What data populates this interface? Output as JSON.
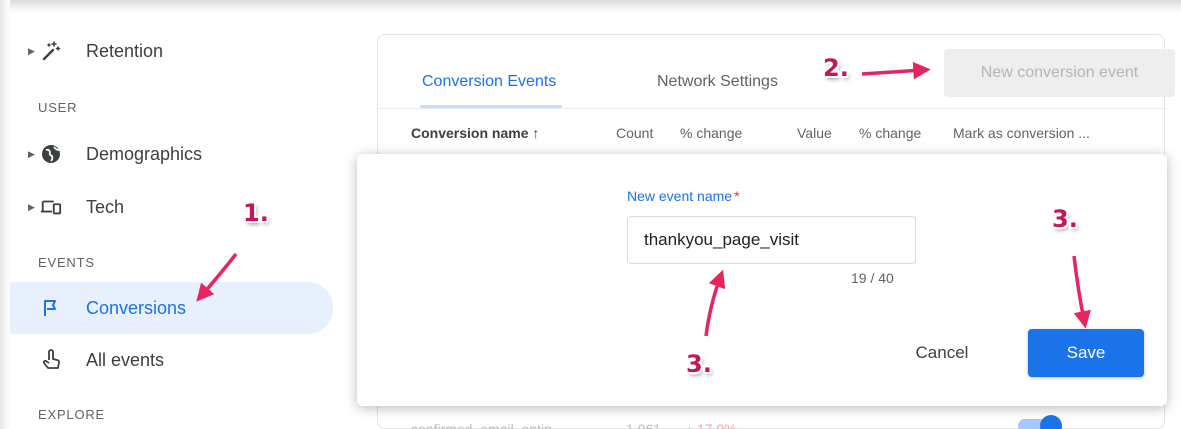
{
  "sidebar": {
    "items": [
      {
        "label": "Retention",
        "icon": "magic-wand-icon"
      },
      {
        "label": "Demographics",
        "icon": "globe-icon"
      },
      {
        "label": "Tech",
        "icon": "devices-icon"
      },
      {
        "label": "Conversions",
        "icon": "flag-icon",
        "active": true
      },
      {
        "label": "All events",
        "icon": "touch-icon"
      }
    ],
    "sections": {
      "user": "USER",
      "events": "EVENTS",
      "explore": "EXPLORE"
    }
  },
  "main": {
    "tabs": [
      "Conversion Events",
      "Network Settings"
    ],
    "new_button": "New conversion event",
    "columns": [
      "Conversion name ↑",
      "Count",
      "% change",
      "Value",
      "% change",
      "Mark as conversion ..."
    ],
    "faded_row": {
      "name": "confirmed_email_optin",
      "count": "1,061",
      "change": "↓ 17.0%"
    }
  },
  "dialog": {
    "field_label": "New event name",
    "required_marker": "*",
    "field_value": "thankyou_page_visit",
    "char_count": "19 / 40",
    "cancel": "Cancel",
    "save": "Save"
  },
  "annotations": {
    "step1": "1.",
    "step2": "2.",
    "step3a": "3.",
    "step3b": "3."
  },
  "colors": {
    "accent": "#1a73e8",
    "active_bg": "#e8f0fe",
    "annotation": "#c2185b",
    "annotation_arrow": "#e8245e"
  }
}
